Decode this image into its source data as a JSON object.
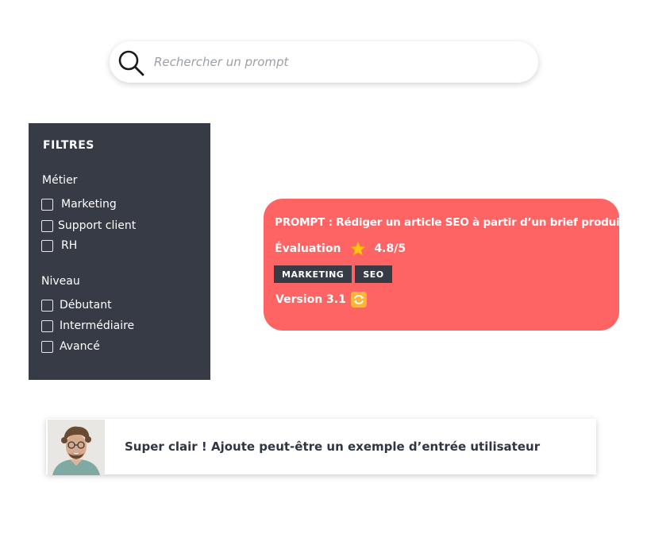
{
  "search": {
    "placeholder": "Rechercher un prompt",
    "icon": "search-icon"
  },
  "filters": {
    "title": "FILTRES",
    "groups": [
      {
        "title": "Métier",
        "options": [
          {
            "label": "Marketing",
            "checked": false
          },
          {
            "label": "Support client",
            "checked": false
          },
          {
            "label": "RH",
            "checked": false
          }
        ]
      },
      {
        "title": "Niveau",
        "options": [
          {
            "label": "Débutant",
            "checked": false
          },
          {
            "label": "Intermédiaire",
            "checked": false
          },
          {
            "label": "Avancé",
            "checked": false
          }
        ]
      }
    ]
  },
  "prompt_card": {
    "title": "PROMPT : Rédiger un article SEO à partir d’un brief produit",
    "rating_label": "Évaluation",
    "rating_icon": "star-icon",
    "rating_value": "4.8/5",
    "tags": [
      "MARKETING",
      "SEO"
    ],
    "version": "Version 3.1",
    "version_icon": "sync-icon",
    "background_color": "#ff6465"
  },
  "comment": {
    "avatar": "avatar",
    "text": "Super clair ! Ajoute peut-être un exemple d’entrée utilisateur"
  },
  "colors": {
    "panel": "#363b45",
    "accent": "#ff6465",
    "star": "#ffc21a"
  }
}
